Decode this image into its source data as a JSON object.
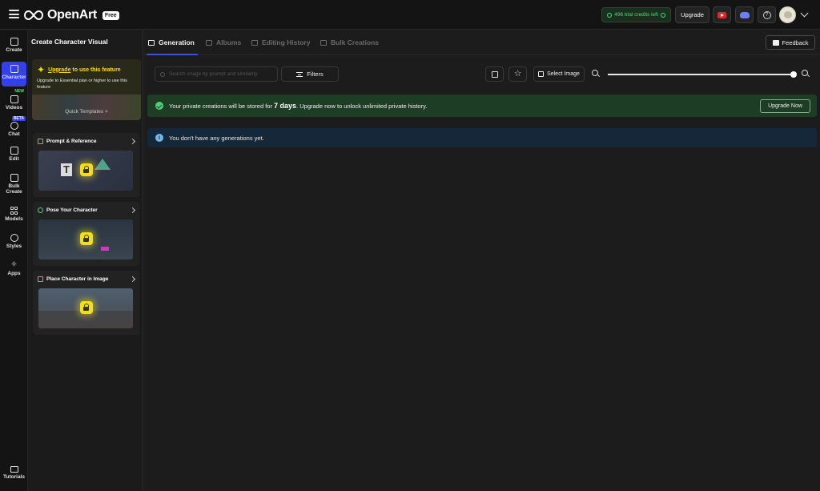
{
  "header": {
    "logo_text": "OpenArt",
    "plan_badge": "Free",
    "credits_text": "496 trial credits left",
    "upgrade_label": "Upgrade",
    "icons": [
      "menu-icon",
      "youtube-icon",
      "discord-icon",
      "help-icon",
      "avatar",
      "chevron-down-icon"
    ]
  },
  "rail": {
    "items": [
      {
        "label": "Create",
        "icon": "create-icon"
      },
      {
        "label": "Character",
        "icon": "character-icon",
        "active": true
      },
      {
        "label": "Videos",
        "icon": "videos-icon",
        "badge": "NEW"
      },
      {
        "label": "Chat",
        "icon": "chat-icon",
        "badge": "BETA"
      },
      {
        "label": "Edit",
        "icon": "edit-icon"
      },
      {
        "label": "Bulk Create",
        "icon": "bulk-create-icon"
      },
      {
        "label": "Models",
        "icon": "models-icon"
      },
      {
        "label": "Styles",
        "icon": "styles-icon"
      },
      {
        "label": "Apps",
        "icon": "apps-icon"
      }
    ],
    "tutorials_label": "Tutorials"
  },
  "character_panel": {
    "title": "Create Character Visual",
    "upgrade_link": "Upgrade",
    "upgrade_suffix": " to use this feature",
    "upgrade_sub": "Upgrade to Essential plan or higher to use this feature",
    "quick_templates": "Quick Templates >",
    "cards": [
      {
        "title": "Prompt & Reference"
      },
      {
        "title": "Pose Your Character"
      },
      {
        "title": "Place Character in Image"
      }
    ]
  },
  "tabs": [
    {
      "label": "Generation",
      "active": true
    },
    {
      "label": "Albums"
    },
    {
      "label": "Editing History"
    },
    {
      "label": "Bulk Creations"
    }
  ],
  "feedback_label": "Feedback",
  "toolbar": {
    "search_placeholder": "Search image by prompt and similarity",
    "filters_label": "Filters",
    "select_image_label": "Select Image",
    "zoom_level": 1.0
  },
  "banners": {
    "storage_prefix": "Your private creations will be stored for ",
    "storage_days": "7 days",
    "storage_suffix": ". Upgrade now to unlock unlimited private history.",
    "upgrade_now_label": "Upgrade Now",
    "empty_message": "You don't have any generations yet."
  },
  "colors": {
    "accent": "#3440e8",
    "upgrade_yellow": "#f5d800",
    "success_green": "#4ed07a",
    "info_blue": "#73b6f0"
  }
}
